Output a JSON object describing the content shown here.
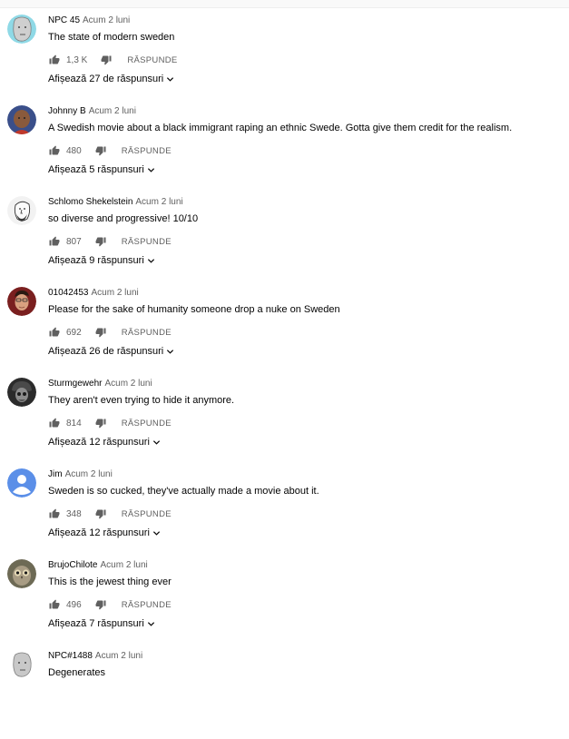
{
  "reply_label": "RĂSPUNDE",
  "comments": [
    {
      "author": "NPC 45",
      "time": "Acum 2 luni",
      "text": "The state of modern sweden",
      "likes": "1,3 K",
      "replies": "Afișează 27 de răspunsuri",
      "avatar_icon": "npc-avatar-icon",
      "avatar_color": "#8fd9e6"
    },
    {
      "author": "Johnny B",
      "time": "Acum 2 luni",
      "text": "A Swedish movie about a black immigrant raping an ethnic Swede. Gotta give them credit for the realism.",
      "likes": "480",
      "replies": "Afișează 5 răspunsuri",
      "avatar_icon": "bald-man-avatar-icon",
      "avatar_color": "#3a4f8a"
    },
    {
      "author": "Schlomo Shekelstein",
      "time": "Acum 2 luni",
      "text": "so diverse and progressive! 10/10",
      "likes": "807",
      "replies": "Afișează 9 răspunsuri",
      "avatar_icon": "cartoon-face-avatar-icon",
      "avatar_color": "#f2f2f2"
    },
    {
      "author": "01042453",
      "time": "Acum 2 luni",
      "text": "Please for the sake of humanity someone drop a nuke on Sweden",
      "likes": "692",
      "replies": "Afișează 26 de răspunsuri",
      "avatar_icon": "man-portrait-avatar-icon",
      "avatar_color": "#7a1f1f"
    },
    {
      "author": "Sturmgewehr",
      "time": "Acum 2 luni",
      "text": "They aren't even trying to hide it anymore.",
      "likes": "814",
      "replies": "Afișează 12 răspunsuri",
      "avatar_icon": "soldier-avatar-icon",
      "avatar_color": "#2b2b2b"
    },
    {
      "author": "Jim",
      "time": "Acum 2 luni",
      "text": "Sweden is so cucked, they've actually made a movie about it.",
      "likes": "348",
      "replies": "Afișează 12 răspunsuri",
      "avatar_icon": "default-person-avatar-icon",
      "avatar_color": "#5b8fe8"
    },
    {
      "author": "BrujoChilote",
      "time": "Acum 2 luni",
      "text": "This is the jewest thing ever",
      "likes": "496",
      "replies": "Afișează 7 răspunsuri",
      "avatar_icon": "owl-avatar-icon",
      "avatar_color": "#6d6a55"
    },
    {
      "author": "NPC#1488",
      "time": "Acum 2 luni",
      "text": "Degenerates",
      "likes": "",
      "replies": "",
      "avatar_icon": "npc-avatar-icon",
      "avatar_color": "#ffffff"
    }
  ]
}
